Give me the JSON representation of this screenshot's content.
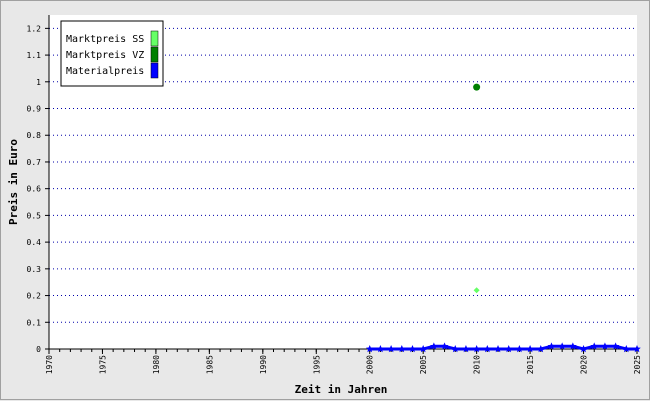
{
  "chart_data": {
    "type": "scatter",
    "xlabel": "Zeit in Jahren",
    "ylabel": "Preis in Euro",
    "xlim": [
      1970,
      2025
    ],
    "ylim": [
      0,
      1.25
    ],
    "x_ticks": [
      1970,
      1975,
      1980,
      1985,
      1990,
      1995,
      2000,
      2005,
      2010,
      2015,
      2020,
      2025
    ],
    "y_ticks": [
      0,
      0.1,
      0.2,
      0.3,
      0.4,
      0.5,
      0.6,
      0.7,
      0.8,
      0.9,
      1,
      1.1,
      1.2
    ],
    "grid": "horizontal dotted",
    "legend_position": "top-left",
    "series": [
      {
        "name": "Marktpreis SS",
        "color": "#66ff66",
        "marker": "diamond",
        "points": [
          [
            2010,
            0.22
          ]
        ]
      },
      {
        "name": "Marktpreis VZ",
        "color": "#008000",
        "marker": "circle",
        "points": [
          [
            2010,
            0.98
          ]
        ]
      },
      {
        "name": "Materialpreis",
        "color": "#0000ff",
        "marker": "star",
        "line": true,
        "points": [
          [
            2000,
            0.0
          ],
          [
            2001,
            0.0
          ],
          [
            2002,
            0.0
          ],
          [
            2003,
            0.0
          ],
          [
            2004,
            0.0
          ],
          [
            2005,
            0.0
          ],
          [
            2006,
            0.01
          ],
          [
            2007,
            0.01
          ],
          [
            2008,
            0.0
          ],
          [
            2009,
            0.0
          ],
          [
            2010,
            0.0
          ],
          [
            2011,
            0.0
          ],
          [
            2012,
            0.0
          ],
          [
            2013,
            0.0
          ],
          [
            2014,
            0.0
          ],
          [
            2015,
            0.0
          ],
          [
            2016,
            0.0
          ],
          [
            2017,
            0.01
          ],
          [
            2018,
            0.01
          ],
          [
            2019,
            0.01
          ],
          [
            2020,
            0.0
          ],
          [
            2021,
            0.01
          ],
          [
            2022,
            0.01
          ],
          [
            2023,
            0.01
          ],
          [
            2024,
            0.0
          ],
          [
            2025,
            0.0
          ]
        ]
      }
    ]
  }
}
